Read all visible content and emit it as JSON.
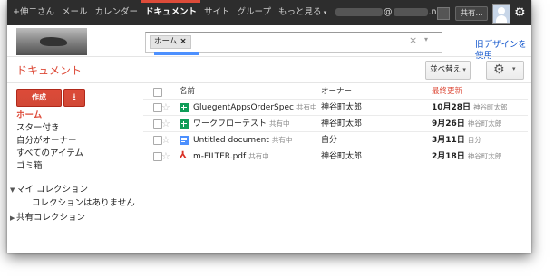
{
  "topbar": {
    "nav": [
      "+伸二さん",
      "メール",
      "カレンダー",
      "ドキュメント",
      "サイト",
      "グループ",
      "もっと見る"
    ],
    "active_index": 3,
    "account_suffix": "@",
    "account_domain": ".net",
    "share_label": "共有..."
  },
  "search": {
    "chip_label": "ホーム",
    "chip_remove": "×",
    "clear": "×",
    "dropdown": "▾"
  },
  "old_design_link": "旧デザインを\n使用",
  "page_title": "ドキュメント",
  "sort_label": "並べ替え",
  "create_label": "作成",
  "sidebar": {
    "items": [
      "ホーム",
      "スター付き",
      "自分がオーナー",
      "すべてのアイテム",
      "ゴミ箱"
    ],
    "my_collections": "マイ コレクション",
    "no_collections": "コレクションはありません",
    "shared_collections": "共有コレクション"
  },
  "table": {
    "headers": {
      "name": "名前",
      "owner": "オーナー",
      "modified": "最終更新"
    },
    "header_modified_color": "#dd4b39",
    "rows": [
      {
        "icon": "spreadsheet-icon",
        "name": "GluegentAppsOrderSpec",
        "shared": "共有中",
        "owner": "神谷町太郎",
        "date": "10月28日",
        "by": "神谷町太郎"
      },
      {
        "icon": "spreadsheet-icon",
        "name": "ワークフローテスト",
        "shared": "共有中",
        "owner": "神谷町太郎",
        "date": "9月26日",
        "by": "神谷町太郎"
      },
      {
        "icon": "document-icon",
        "name": "Untitled document",
        "shared": "共有中",
        "owner": "自分",
        "date": "3月11日",
        "by": "自分"
      },
      {
        "icon": "pdf-icon",
        "name": "m-FILTER.pdf",
        "shared": "共有中",
        "owner": "神谷町太郎",
        "date": "2月18日",
        "by": "神谷町太郎"
      }
    ]
  },
  "colors": {
    "accent": "#dd4b39",
    "link": "#1155cc",
    "topbar": "#2d2d2d",
    "search_underline": "#4d90fe"
  }
}
